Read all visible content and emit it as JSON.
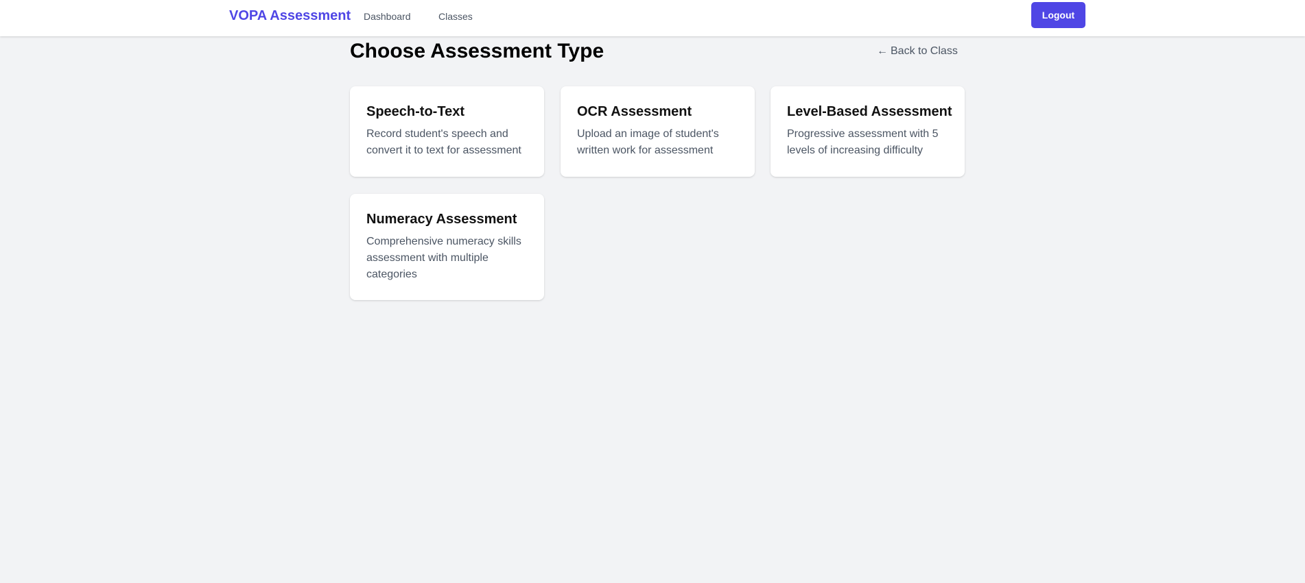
{
  "navbar": {
    "brand": "VOPA Assessment",
    "links": [
      {
        "label": "Dashboard"
      },
      {
        "label": "Classes"
      }
    ],
    "logout_label": "Logout"
  },
  "main": {
    "title": "Choose Assessment Type",
    "back_link": {
      "arrow": "←",
      "label": "Back to Class"
    },
    "cards": [
      {
        "title": "Speech-to-Text",
        "description": "Record student's speech and convert it to text for assessment"
      },
      {
        "title": "OCR Assessment",
        "description": "Upload an image of student's written work for assessment"
      },
      {
        "title": "Level-Based Assessment",
        "description": "Progressive assessment with 5 levels of increasing difficulty"
      },
      {
        "title": "Numeracy Assessment",
        "description": "Comprehensive numeracy skills assessment with multiple categories"
      }
    ]
  },
  "colors": {
    "accent": "#4f46e5",
    "background": "#f2f3f5",
    "card": "#ffffff",
    "muted_text": "#4b5563"
  }
}
